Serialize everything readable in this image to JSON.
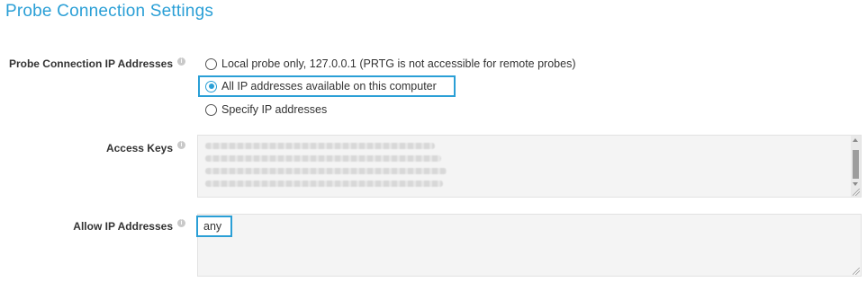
{
  "section": {
    "title": "Probe Connection Settings"
  },
  "probe_connection": {
    "label": "Probe Connection IP Addresses",
    "options": [
      {
        "label": "Local probe only, 127.0.0.1 (PRTG is not accessible for remote probes)",
        "selected": false
      },
      {
        "label": "All IP addresses available on this computer",
        "selected": true
      },
      {
        "label": "Specify IP addresses",
        "selected": false
      }
    ]
  },
  "access_keys": {
    "label": "Access Keys"
  },
  "allow_ip": {
    "label": "Allow IP Addresses",
    "value": "any"
  },
  "colors": {
    "accent": "#2a9fd6",
    "field_background": "#f4f4f4"
  },
  "icons": {
    "info": "info-icon",
    "resize": "resize-grip-icon"
  }
}
